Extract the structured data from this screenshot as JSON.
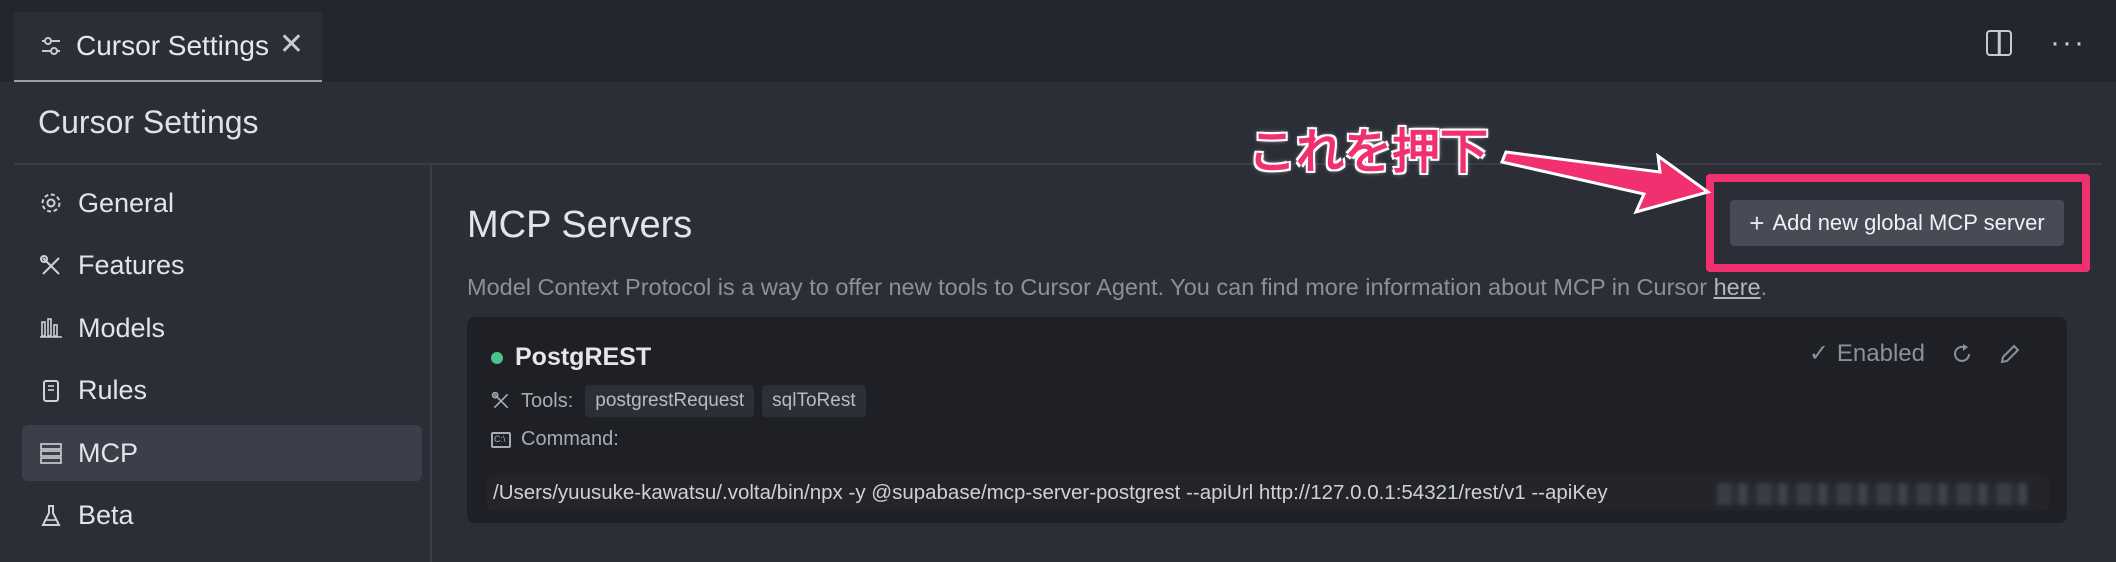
{
  "tab": {
    "label": "Cursor Settings",
    "close": "✕"
  },
  "top_actions": {
    "more": "···"
  },
  "settings_title": "Cursor Settings",
  "sidebar": {
    "items": [
      {
        "label": "General",
        "icon": "gear-icon"
      },
      {
        "label": "Features",
        "icon": "tools-icon"
      },
      {
        "label": "Models",
        "icon": "bar-chart-icon"
      },
      {
        "label": "Rules",
        "icon": "book-icon"
      },
      {
        "label": "MCP",
        "icon": "server-icon",
        "active": true
      },
      {
        "label": "Beta",
        "icon": "flask-icon"
      }
    ]
  },
  "main": {
    "title": "MCP Servers",
    "description": "Model Context Protocol is a way to offer new tools to Cursor Agent. You can find more information about MCP in Cursor ",
    "description_link": "here",
    "description_end": ".",
    "add_button": {
      "plus": "+",
      "label": "Add new global MCP server"
    }
  },
  "annotation": {
    "text": "これを押下",
    "color": "#f0306f"
  },
  "server": {
    "name": "PostgREST",
    "status_color": "#4cc38a",
    "enabled_label": "Enabled",
    "tools_label": "Tools:",
    "tools": [
      "postgrestRequest",
      "sqlToRest"
    ],
    "command_label": "Command:",
    "command": "/Users/yuusuke-kawatsu/.volta/bin/npx -y @supabase/mcp-server-postgrest --apiUrl http://127.0.0.1:54321/rest/v1 --apiKey"
  }
}
